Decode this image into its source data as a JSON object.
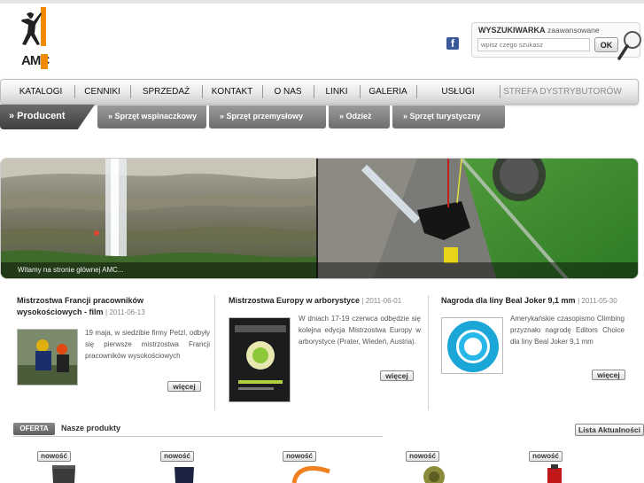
{
  "header": {
    "logo_text": "AMC",
    "search": {
      "title": "WYSZUKIWARKA",
      "advanced": "zaawansowane",
      "placeholder": "wpisz czego szukasz",
      "ok_label": "OK"
    }
  },
  "nav": {
    "items": [
      {
        "label": "KATALOGI"
      },
      {
        "label": "CENNIKI"
      },
      {
        "label": "SPRZEDAŻ"
      },
      {
        "label": "KONTAKT"
      },
      {
        "label": "O NAS"
      },
      {
        "label": "LINKI"
      },
      {
        "label": "GALERIA"
      },
      {
        "label": "USŁUGI"
      },
      {
        "label": "STREFA DYSTRYBUTORÓW"
      }
    ]
  },
  "subnav": {
    "active": "» Producent",
    "tabs": [
      {
        "label": "» Sprzęt wspinaczkowy"
      },
      {
        "label": "» Sprzęt przemysłowy"
      },
      {
        "label": "» Odzież"
      },
      {
        "label": "» Sprzęt turystyczny"
      }
    ]
  },
  "banner": {
    "caption": "Witamy na stronie głównej AMC..."
  },
  "news": [
    {
      "title": "Mistrzostwa Francji pracowników wysokościowych - film",
      "date": "| 2011-06-13",
      "body": "19 maja, w siedzibie firmy Petzl, odbyły się pierwsze mistrzostwa Francji pracowników wysokościowych",
      "more": "więcej"
    },
    {
      "title": "Mistrzostwa Europy w arborystyce",
      "date": "| 2011-06-01",
      "body": "W dniach 17-19 czerwca odbędzie się kolejna edycja Mistrzostwa Europy w arborystyce (Prater, Wiedeń, Austria).",
      "more": "więcej"
    },
    {
      "title": "Nagroda dla liny Beal Joker 9,1 mm",
      "date": "| 2011-05-30",
      "body": "Amerykańskie czasopismo Climbing przyznało nagrodę Editors Choice dla liny Beal Joker 9,1 mm",
      "more": "więcej"
    }
  ],
  "offer": {
    "tab": "OFERTA",
    "label": "Nasze produkty",
    "lista": "Lista Aktualności",
    "badges": [
      "nowość",
      "nowość",
      "nowość",
      "nowość",
      "nowość"
    ]
  },
  "colors": {
    "logo_orange": "#f08a00",
    "nav_dark": "#4a4a4a",
    "fb_blue": "#3b5998"
  }
}
